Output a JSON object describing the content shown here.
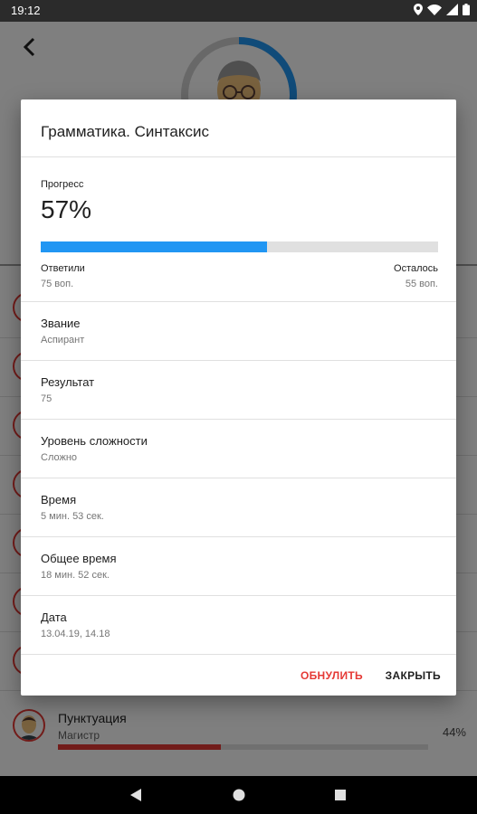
{
  "status_bar": {
    "time": "19:12"
  },
  "background": {
    "last_item": {
      "title": "Пунктуация",
      "subtitle": "Магистр",
      "percent": "44%",
      "progress": 0.44
    }
  },
  "dialog": {
    "title": "Грамматика. Синтаксис",
    "progress_label": "Прогресс",
    "progress_value": "57%",
    "progress_fraction": 0.57,
    "answered_label": "Ответили",
    "answered_value": "75 воп.",
    "remaining_label": "Осталось",
    "remaining_value": "55 воп.",
    "rows": [
      {
        "label": "Звание",
        "value": "Аспирант"
      },
      {
        "label": "Результат",
        "value": "75"
      },
      {
        "label": "Уровень сложности",
        "value": "Сложно"
      },
      {
        "label": "Время",
        "value": "5 мин. 53 сек."
      },
      {
        "label": "Общее время",
        "value": "18 мин. 52 сек."
      },
      {
        "label": "Дата",
        "value": "13.04.19, 14.18"
      }
    ],
    "reset_label": "ОБНУЛИТЬ",
    "close_label": "ЗАКРЫТЬ"
  },
  "colors": {
    "accent": "#2196f3",
    "danger": "#e53935"
  },
  "icons": [
    "back-arrow-icon",
    "location-icon",
    "wifi-icon",
    "signal-icon",
    "battery-icon",
    "nav-back-icon",
    "nav-home-icon",
    "nav-recent-icon"
  ]
}
